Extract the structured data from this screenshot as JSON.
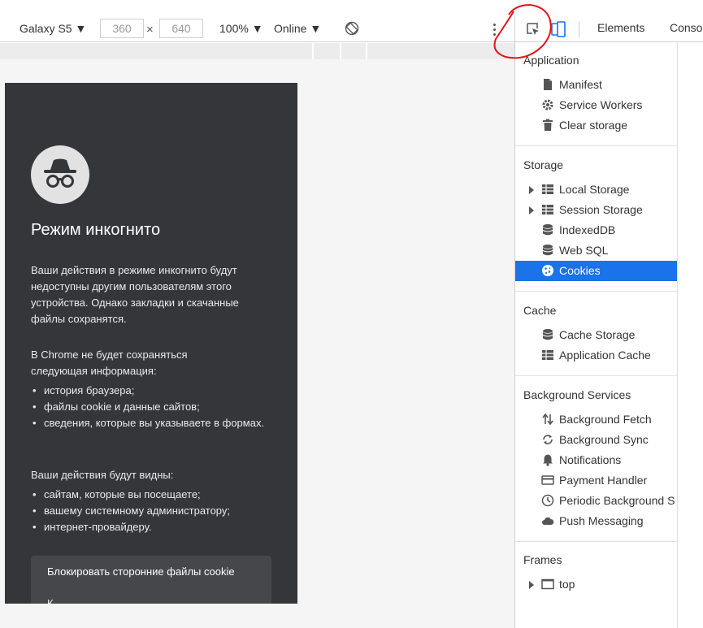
{
  "toolbar": {
    "device": "Galaxy S5 ▼",
    "width": "360",
    "times": "×",
    "height": "640",
    "zoom": "100% ▼",
    "network": "Online ▼"
  },
  "devtools": {
    "tabs": [
      "Elements",
      "Conso"
    ],
    "sections": {
      "application": {
        "title": "Application",
        "items": [
          {
            "label": "Manifest",
            "icon": "file-icon"
          },
          {
            "label": "Service Workers",
            "icon": "gear-icon"
          },
          {
            "label": "Clear storage",
            "icon": "trash-icon"
          }
        ]
      },
      "storage": {
        "title": "Storage",
        "items": [
          {
            "label": "Local Storage",
            "icon": "grid-icon"
          },
          {
            "label": "Session Storage",
            "icon": "grid-icon"
          },
          {
            "label": "IndexedDB",
            "icon": "database-icon"
          },
          {
            "label": "Web SQL",
            "icon": "database-icon"
          },
          {
            "label": "Cookies",
            "icon": "cookie-icon",
            "selected": true
          }
        ]
      },
      "cache": {
        "title": "Cache",
        "items": [
          {
            "label": "Cache Storage",
            "icon": "database-icon"
          },
          {
            "label": "Application Cache",
            "icon": "grid-icon"
          }
        ]
      },
      "background": {
        "title": "Background Services",
        "items": [
          {
            "label": "Background Fetch",
            "icon": "fetch-arrows-icon"
          },
          {
            "label": "Background Sync",
            "icon": "sync-icon"
          },
          {
            "label": "Notifications",
            "icon": "bell-icon"
          },
          {
            "label": "Payment Handler",
            "icon": "card-icon"
          },
          {
            "label": "Periodic Background S",
            "icon": "clock-icon"
          },
          {
            "label": "Push Messaging",
            "icon": "cloud-icon"
          }
        ]
      },
      "frames": {
        "title": "Frames",
        "items": [
          {
            "label": "top",
            "icon": "frame-icon"
          }
        ]
      }
    },
    "colors": {
      "selected": "#1a73e8"
    }
  },
  "page": {
    "title": "Режим инкогнито",
    "intro": [
      "Ваши действия в режиме инкогнито будут",
      "недоступны другим пользователям этого",
      "устройства. Однако закладки и скачанные",
      "файлы сохранятся."
    ],
    "not_saved_heading": [
      "В Chrome не будет сохраняться",
      "следующая информация:"
    ],
    "not_saved": [
      "история браузера;",
      "файлы cookie и данные сайтов;",
      "сведения, которые вы указываете в формах."
    ],
    "visible_heading": "Ваши действия будут видны:",
    "visible_to": [
      "сайтам, которые вы посещаете;",
      "вашему системному администратору;",
      "интернет-провайдеру."
    ],
    "card_title": "Блокировать сторонние файлы cookie",
    "card_sub": "К"
  }
}
